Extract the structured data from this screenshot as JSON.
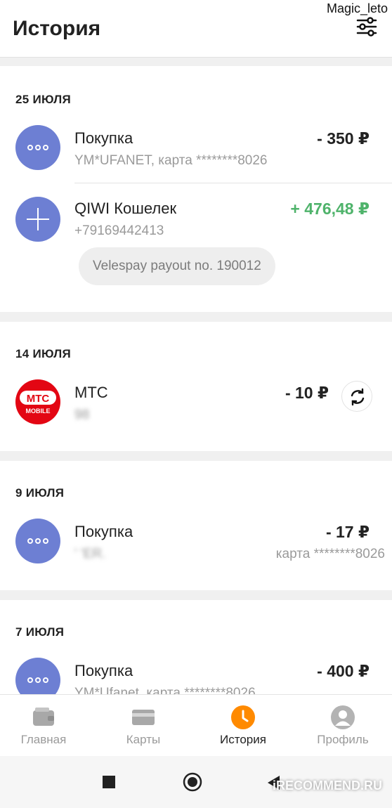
{
  "watermark_user": "Magic_leto",
  "header": {
    "title": "История",
    "filter_icon": "filter-sliders-icon"
  },
  "groups": [
    {
      "date": "25 ИЮЛЯ",
      "transactions": [
        {
          "title": "Покупка",
          "subtitle": "YM*UFANET, карта ********8026",
          "amount": "- 350 ₽",
          "icon": "more-dots-icon"
        },
        {
          "title": "QIWI Кошелек",
          "subtitle": "+79169442413",
          "amount": "+ 476,48 ₽",
          "icon": "plus-icon",
          "comment": "Velespay payout no. 190012"
        }
      ]
    },
    {
      "date": "14 ИЮЛЯ",
      "transactions": [
        {
          "title": "МТС",
          "subtitle": "98",
          "amount": "- 10 ₽",
          "icon": "mts-logo",
          "logo_text_1": "МТС",
          "logo_text_2": "MOBILE",
          "action_icon": "repeat-icon"
        }
      ]
    },
    {
      "date": "9 ИЮЛЯ",
      "transactions": [
        {
          "title": "Покупка",
          "subtitle_left": "' 'ER.",
          "subtitle_right": "карта ********8026",
          "amount": "- 17 ₽",
          "icon": "more-dots-icon"
        }
      ]
    },
    {
      "date": "7 ИЮЛЯ",
      "transactions": [
        {
          "title": "Покупка",
          "subtitle": "YM*Ufanet, карта ********8026",
          "amount": "- 400 ₽",
          "icon": "more-dots-icon"
        }
      ]
    }
  ],
  "bottom_nav": [
    {
      "label": "Главная",
      "icon": "wallet-icon",
      "active": false
    },
    {
      "label": "Карты",
      "icon": "card-icon",
      "active": false
    },
    {
      "label": "История",
      "icon": "clock-icon",
      "active": true
    },
    {
      "label": "Профиль",
      "icon": "profile-icon",
      "active": false
    }
  ],
  "system_nav": [
    "square-icon",
    "circle-icon",
    "back-triangle-icon"
  ],
  "watermark_brand": "iRECOMMEND.RU",
  "colors": {
    "accent": "#ff8a00",
    "avatar": "#6d7fd3",
    "plus": "#4fb36b",
    "mts": "#e30613"
  }
}
